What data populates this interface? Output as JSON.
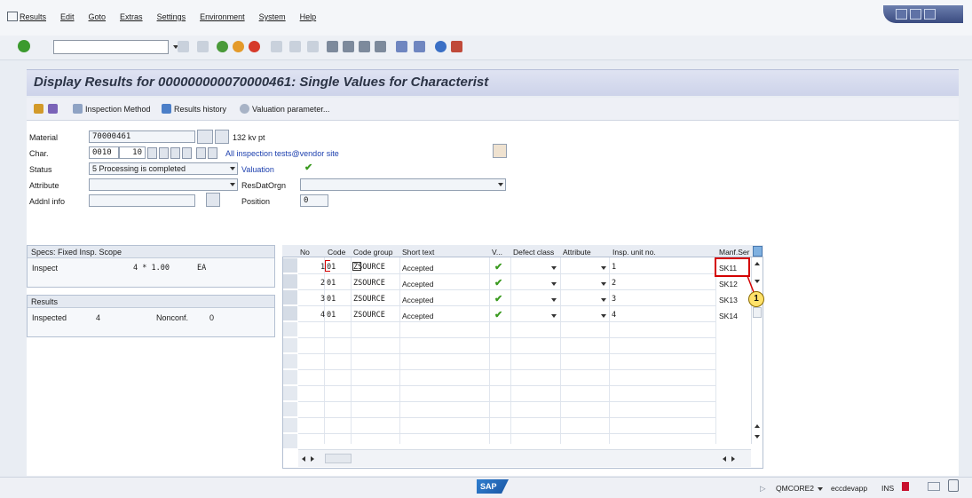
{
  "menu": [
    "Results",
    "Edit",
    "Goto",
    "Extras",
    "Settings",
    "Environment",
    "System",
    "Help"
  ],
  "title": "Display Results for 000000000070000461: Single Values for Characterist",
  "app_toolbar": {
    "inspection_method": "Inspection Method",
    "results_history": "Results history",
    "valuation_parameter": "Valuation parameter..."
  },
  "header": {
    "material_label": "Material",
    "material_value": "70000461",
    "material_desc": "132 kv pt",
    "char_label": "Char.",
    "char_value": "0010",
    "char_num": "10",
    "char_desc": "All inspection tests@vendor site",
    "status_label": "Status",
    "status_value": "5 Processing is completed",
    "valuation_label": "Valuation",
    "attribute_label": "Attribute",
    "resdat_label": "ResDatOrgn",
    "addnl_label": "Addnl info",
    "position_label": "Position",
    "position_value": "0"
  },
  "specs": {
    "title": "Specs: Fixed Insp. Scope",
    "inspect_label": "Inspect",
    "inspect_value": "4 * 1.00",
    "unit": "EA"
  },
  "results": {
    "title": "Results",
    "inspected_label": "Inspected",
    "inspected_value": "4",
    "nonconf_label": "Nonconf.",
    "nonconf_value": "0"
  },
  "table": {
    "columns": [
      "No",
      "Code",
      "Code group",
      "Short text",
      "V...",
      "Defect class",
      "Attribute",
      "Insp. unit no.",
      "Manf.Ser"
    ],
    "rows": [
      {
        "no": "1",
        "code": "01",
        "group": "ZSOURCE",
        "short": "Accepted",
        "unit": "1",
        "manf": "SK11"
      },
      {
        "no": "2",
        "code": "01",
        "group": "ZSOURCE",
        "short": "Accepted",
        "unit": "2",
        "manf": "SK12"
      },
      {
        "no": "3",
        "code": "01",
        "group": "ZSOURCE",
        "short": "Accepted",
        "unit": "3",
        "manf": "SK13"
      },
      {
        "no": "4",
        "code": "01",
        "group": "ZSOURCE",
        "short": "Accepted",
        "unit": "4",
        "manf": "SK14"
      }
    ]
  },
  "callout_number": "1",
  "status_bar": {
    "logo": "SAP",
    "tcode": "QMCORE2",
    "server": "eccdevapp",
    "mode": "INS"
  },
  "colors": {
    "title_bg": "#d6dbef",
    "highlight": "#d40000",
    "check": "#3a9a1f"
  }
}
